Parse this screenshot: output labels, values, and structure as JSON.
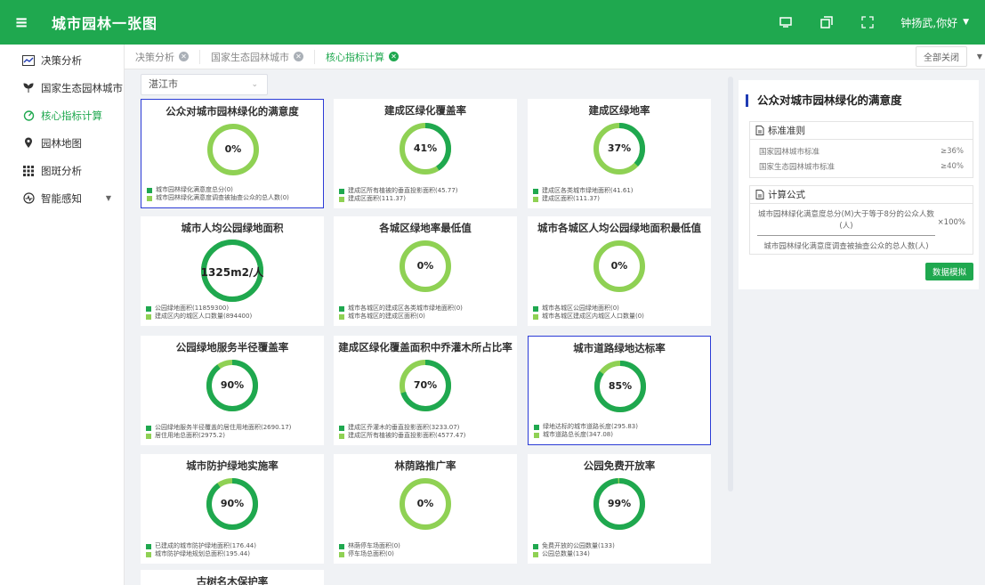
{
  "header": {
    "menu_icon": "menu-icon",
    "title": "城市园林一张图",
    "user": "钟扬武,你好",
    "icons": [
      "fullscreen-icon",
      "window-icon",
      "expand-icon"
    ]
  },
  "sidebar": {
    "items": [
      {
        "label": "决策分析",
        "icon": "chart-icon",
        "active": false
      },
      {
        "label": "国家生态园林城市",
        "icon": "plant-icon",
        "active": false
      },
      {
        "label": "核心指标计算",
        "icon": "gauge-icon",
        "active": true
      },
      {
        "label": "园林地图",
        "icon": "map-pin-icon",
        "active": false
      },
      {
        "label": "图斑分析",
        "icon": "grid-icon",
        "active": false
      },
      {
        "label": "智能感知",
        "icon": "sensor-icon",
        "active": false
      }
    ]
  },
  "tabs": [
    {
      "label": "决策分析",
      "active": false
    },
    {
      "label": "国家生态园林城市",
      "active": false
    },
    {
      "label": "核心指标计算",
      "active": true
    }
  ],
  "close_all": "全部关闭",
  "city_select": {
    "value": "湛江市"
  },
  "cards": [
    {
      "title": "公众对城市园林绿化的满意度",
      "value": "0%",
      "percent": 0,
      "selected": true,
      "legend": [
        "城市园林绿化满意度总分(0)",
        "城市园林绿化满意度调查被抽查公众的总人数(0)"
      ]
    },
    {
      "title": "建成区绿化覆盖率",
      "value": "41%",
      "percent": 41,
      "selected": false,
      "legend": [
        "建成区所有植被的垂直投影面积(45.77)",
        "建成区面积(111.37)"
      ]
    },
    {
      "title": "建成区绿地率",
      "value": "37%",
      "percent": 37,
      "selected": false,
      "legend": [
        "建成区各类城市绿地面积(41.61)",
        "建成区面积(111.37)"
      ]
    },
    {
      "title": "城市人均公园绿地面积",
      "value": "1325m2/人",
      "percent": 100,
      "selected": false,
      "big": true,
      "legend": [
        "公园绿地面积(11859300)",
        "建成区内的城区人口数量(894400)"
      ]
    },
    {
      "title": "各城区绿地率最低值",
      "value": "0%",
      "percent": 0,
      "selected": false,
      "legend": [
        "城市各城区的建成区各类城市绿地面积(0)",
        "城市各城区的建成区面积(0)"
      ]
    },
    {
      "title": "城市各城区人均公园绿地面积最低值",
      "value": "0%",
      "percent": 0,
      "selected": false,
      "legend": [
        "城市各城区公园绿地面积(0)",
        "城市各城区建成区内城区人口数量(0)"
      ]
    },
    {
      "title": "公园绿地服务半径覆盖率",
      "value": "90%",
      "percent": 90,
      "selected": false,
      "legend": [
        "公园绿地服务半径覆盖的居住用地面积(2690.17)",
        "居住用地总面积(2975.2)"
      ]
    },
    {
      "title": "建成区绿化覆盖面积中乔灌木所占比率",
      "value": "70%",
      "percent": 70,
      "selected": false,
      "legend": [
        "建成区乔灌木的垂直投影面积(3233.07)",
        "建成区所有植被的垂直投影面积(4577.47)"
      ]
    },
    {
      "title": "城市道路绿地达标率",
      "value": "85%",
      "percent": 85,
      "selected": true,
      "legend": [
        "绿地达标的城市道路长度(295.83)",
        "城市道路总长度(347.08)"
      ]
    },
    {
      "title": "城市防护绿地实施率",
      "value": "90%",
      "percent": 90,
      "selected": false,
      "legend": [
        "已建成的城市防护绿地面积(176.44)",
        "城市防护绿地规划总面积(195.44)"
      ]
    },
    {
      "title": "林荫路推广率",
      "value": "0%",
      "percent": 0,
      "selected": false,
      "legend": [
        "林荫停车场面积(0)",
        "停车场总面积(0)"
      ]
    },
    {
      "title": "公园免费开放率",
      "value": "99%",
      "percent": 99,
      "selected": false,
      "legend": [
        "免费开放的公园数量(133)",
        "公园总数量(134)"
      ]
    }
  ],
  "partial_card": {
    "title": "古树名木保护率"
  },
  "panel": {
    "title": "公众对城市园林绿化的满意度",
    "standard_head": "标准准则",
    "standards": [
      {
        "label": "国家园林城市标准",
        "value": "≥36%"
      },
      {
        "label": "国家生态园林城市标准",
        "value": "≥40%"
      }
    ],
    "formula_head": "计算公式",
    "formula_num": "城市园林绿化满意度总分(M)大于等于8分的公众人数(人)",
    "formula_den": "城市园林绿化满意度调查被抽查公众的总人数(人)",
    "formula_times": "×100%",
    "simulate": "数据模拟"
  },
  "colors": {
    "primary": "#1fa84f",
    "ring_light": "#8fd154",
    "ring_dark": "#1fa84f",
    "select_border": "#2b3bd6"
  }
}
